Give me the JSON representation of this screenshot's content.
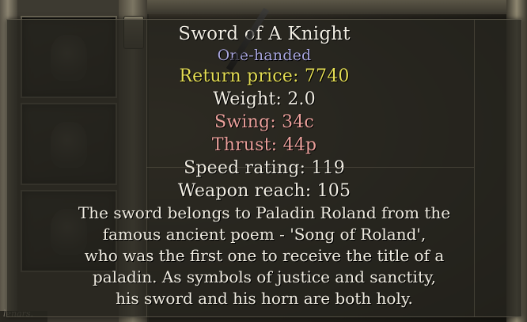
{
  "colors": {
    "name": "#f1ede2",
    "type": "#a9a6dd",
    "price": "#e4dd54",
    "damage": "#eaa09a",
    "stat": "#f1ede2",
    "description": "#f1ede2"
  },
  "background": {
    "watermark": "lenars."
  },
  "item": {
    "name": "Sword of A Knight",
    "type": "One-handed",
    "price": "Return price: 7740",
    "weight": "Weight: 2.0",
    "swing": "Swing: 34c",
    "thrust": "Thrust: 44p",
    "speed": "Speed rating: 119",
    "reach": "Weapon reach: 105",
    "description": [
      "The sword belongs to Paladin Roland from the",
      "famous ancient poem - 'Song of Roland',",
      "who was the first one to receive the title of a",
      "paladin. As symbols of justice and sanctity,",
      "his sword and his horn are both holy."
    ]
  },
  "icons": {
    "inventory_slots": [
      "glove-icon",
      "glove-icon",
      "glove-icon"
    ]
  }
}
